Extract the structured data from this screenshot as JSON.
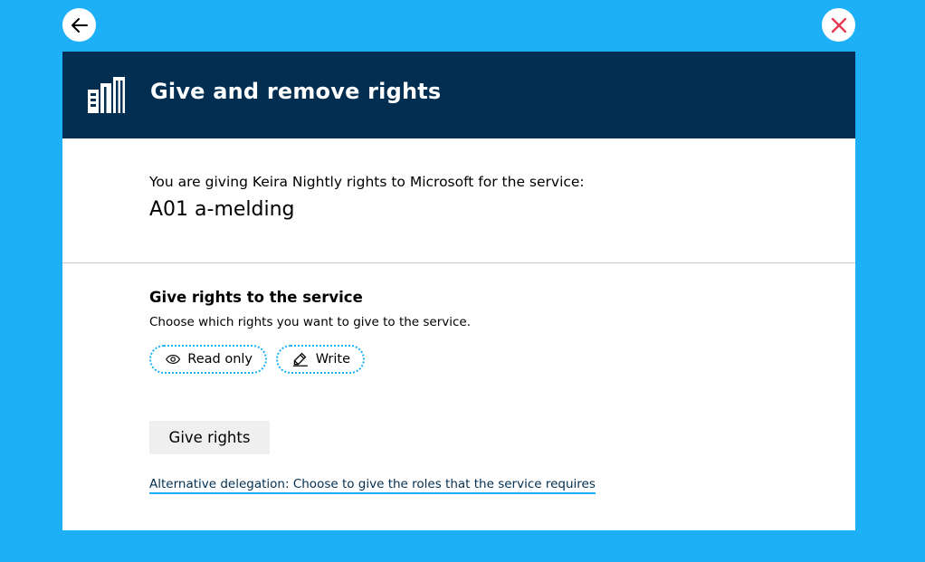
{
  "nav": {
    "back_icon": "arrow-left-icon",
    "close_icon": "close-icon"
  },
  "header": {
    "title": "Give and remove rights",
    "icon": "building-icon"
  },
  "intro": {
    "text": "You are giving Keira Nightly rights to Microsoft for the service:",
    "service_name": "A01 a-melding"
  },
  "rights": {
    "heading": "Give rights to the service",
    "description": "Choose which rights you want to give to the service.",
    "options": [
      {
        "label": "Read only",
        "icon": "eye-icon"
      },
      {
        "label": "Write",
        "icon": "pencil-icon"
      }
    ]
  },
  "actions": {
    "give_rights_label": "Give rights",
    "alternative_link": "Alternative delegation: Choose to give the roles that the service requires"
  },
  "colors": {
    "background": "#1eb0f7",
    "header": "#022f51",
    "close": "#e23b53",
    "link_underline": "#1eb0f7"
  }
}
